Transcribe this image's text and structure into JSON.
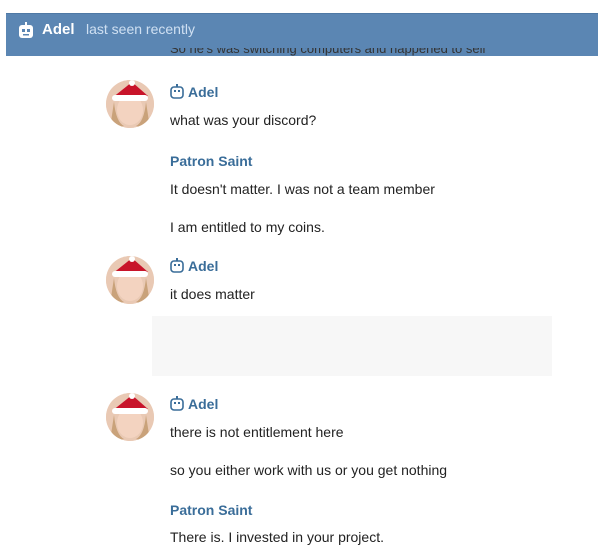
{
  "header": {
    "name": "Adel",
    "status": "last seen recently"
  },
  "partial_top_message": "So he's was switching computers and happened to sell",
  "messages": [
    {
      "sender": "Adel",
      "bot_icon": "robot-icon",
      "avatar": true,
      "texts": [
        "what was your discord?"
      ]
    },
    {
      "sender": "Patron Saint",
      "avatar": false,
      "texts": [
        "It doesn't matter. I was not a team member",
        "I am entitled to my coins."
      ]
    },
    {
      "sender": "Adel",
      "bot_icon": "robot-icon",
      "avatar": true,
      "texts": [
        "it does matter"
      ]
    },
    {
      "sender": "Adel",
      "bot_icon": "robot-icon",
      "avatar": true,
      "texts": [
        "there is not entitlement here",
        "so you either work with us or you get nothing"
      ]
    },
    {
      "sender": "Patron Saint",
      "avatar": false,
      "texts": [
        "There is. I invested in your project."
      ]
    }
  ],
  "colors": {
    "header_bg": "#5b86b3",
    "sender": "#3a6d99"
  }
}
